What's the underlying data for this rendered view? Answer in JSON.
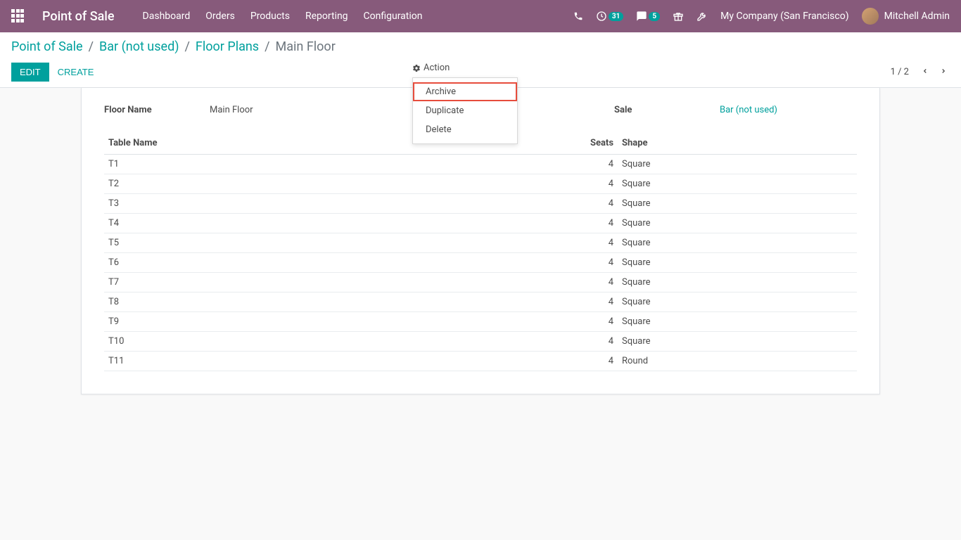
{
  "navbar": {
    "brand": "Point of Sale",
    "menu": [
      "Dashboard",
      "Orders",
      "Products",
      "Reporting",
      "Configuration"
    ],
    "timer_badge": "31",
    "chat_badge": "5",
    "company": "My Company (San Francisco)",
    "user": "Mitchell Admin"
  },
  "breadcrumbs": {
    "parts": [
      "Point of Sale",
      "Bar (not used)",
      "Floor Plans"
    ],
    "current": "Main Floor"
  },
  "buttons": {
    "edit": "EDIT",
    "create": "CREATE",
    "action": "Action"
  },
  "action_menu": {
    "archive": "Archive",
    "duplicate": "Duplicate",
    "delete": "Delete"
  },
  "pager": {
    "text": "1 / 2"
  },
  "form": {
    "floor_name_label": "Floor Name",
    "floor_name_value": "Main Floor",
    "pos_label": "Sale",
    "pos_value": "Bar (not used)"
  },
  "table": {
    "headers": {
      "name": "Table Name",
      "seats": "Seats",
      "shape": "Shape"
    },
    "rows": [
      {
        "name": "T1",
        "seats": 4,
        "shape": "Square"
      },
      {
        "name": "T2",
        "seats": 4,
        "shape": "Square"
      },
      {
        "name": "T3",
        "seats": 4,
        "shape": "Square"
      },
      {
        "name": "T4",
        "seats": 4,
        "shape": "Square"
      },
      {
        "name": "T5",
        "seats": 4,
        "shape": "Square"
      },
      {
        "name": "T6",
        "seats": 4,
        "shape": "Square"
      },
      {
        "name": "T7",
        "seats": 4,
        "shape": "Square"
      },
      {
        "name": "T8",
        "seats": 4,
        "shape": "Square"
      },
      {
        "name": "T9",
        "seats": 4,
        "shape": "Square"
      },
      {
        "name": "T10",
        "seats": 4,
        "shape": "Square"
      },
      {
        "name": "T11",
        "seats": 4,
        "shape": "Round"
      }
    ]
  }
}
